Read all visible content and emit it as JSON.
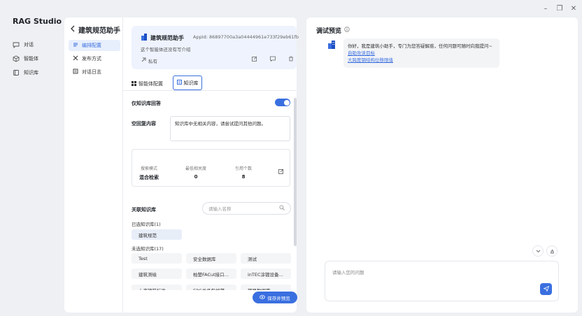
{
  "app": {
    "title": "RAG Studio"
  },
  "window_controls": {
    "minimize": "–",
    "restore": "❐",
    "close": "✕"
  },
  "nav": [
    {
      "label": "对话",
      "icon": "chat-icon"
    },
    {
      "label": "智能体",
      "icon": "agent-icon"
    },
    {
      "label": "知识库",
      "icon": "book-icon"
    }
  ],
  "agent": {
    "title": "建筑规范助手",
    "appid": "AppId: 86897700a3a04444961e733f29eb61fb",
    "description": "这个智能体还没有写介绍",
    "visibility": "私有"
  },
  "subnav": [
    {
      "label": "编排配置",
      "icon": "config-icon",
      "active": true
    },
    {
      "label": "发布方式",
      "icon": "publish-icon",
      "active": false
    },
    {
      "label": "对话日志",
      "icon": "log-icon",
      "active": false
    }
  ],
  "tabs": {
    "agent_config": "智能体配置",
    "knowledge": "知识库"
  },
  "kb_config": {
    "only_kb_label": "仅知识库回答",
    "only_kb_enabled": true,
    "empty_reply_label": "空回复内容",
    "empty_reply_value": "知识库中无相关内容，请尝试提问其他问题。",
    "search_mode_label": "搜索模式",
    "search_mode_value": "混合检索",
    "min_relevance_label": "最低相关度",
    "min_relevance_value": "0",
    "cite_count_label": "引用个数",
    "cite_count_value": "8"
  },
  "kb_list": {
    "title": "关联知识库",
    "search_placeholder": "请输入名称",
    "selected_label": "已选知识库(1)",
    "selected": [
      "建筑规范"
    ],
    "unselected_label": "未选知识库(17)",
    "unselected": [
      "Test",
      "安全数据库",
      "测试",
      "建筑测绘",
      "柏楚FACut接口…",
      "inTEC涂镀设备…",
      "上海建筑标准",
      "EPC总承包规范",
      "项目数据库"
    ]
  },
  "save_button": "保存并预览",
  "preview": {
    "title": "调试预览",
    "greeting": "你好，我是建筑小助手，专门为您答疑解惑，任何问题可随时向我提问~",
    "links": [
      "自助攻读目标",
      "大跨度钢结构位移限值"
    ],
    "input_placeholder": "请输入您的问题"
  },
  "colors": {
    "accent": "#3a6fe0",
    "accent_light": "#e8effc"
  }
}
